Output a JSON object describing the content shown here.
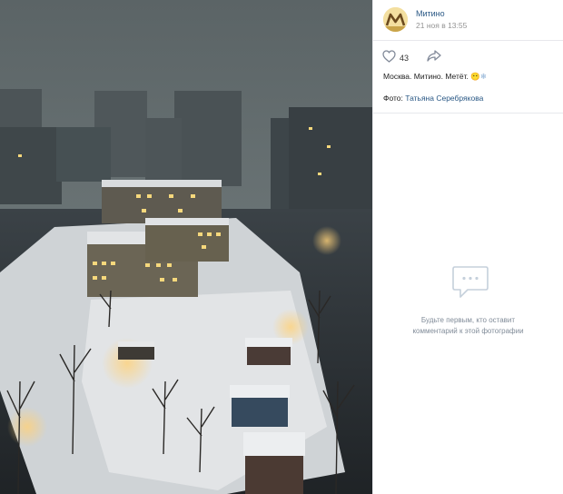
{
  "post": {
    "author": "Митино",
    "date": "21 ноя в 13:55",
    "likes_count": "43",
    "caption": "Москва. Митино. Метёт.",
    "caption_emoji": "😶❄",
    "credit_prefix": "Фото:",
    "credit_name": "Татьяна Серебрякова"
  },
  "comments": {
    "empty_line1": "Будьте первым, кто оставит",
    "empty_line2": "комментарий к этой фотографии"
  },
  "icons": {
    "avatar": "mitino-logo-icon",
    "like": "heart-icon",
    "share": "share-arrow-icon",
    "empty": "comment-bubble-icon"
  },
  "colors": {
    "link": "#2a5885",
    "muted": "#939393",
    "border": "#e7e8ec"
  }
}
